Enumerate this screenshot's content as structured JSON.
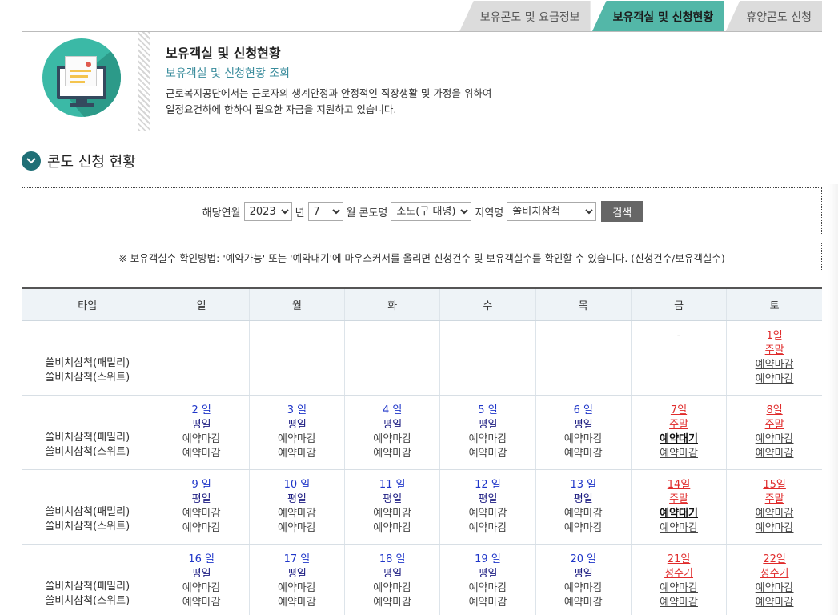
{
  "tabs": [
    {
      "label": "보유콘도 및 요금정보",
      "active": false
    },
    {
      "label": "보유객실 및 신청현황",
      "active": true
    },
    {
      "label": "휴양콘도 신청",
      "active": false
    }
  ],
  "intro": {
    "title": "보유객실 및 신청현황",
    "subtitle": "보유객실 및 신청현황 조회",
    "desc_line1": "근로복지공단에서는 근로자의 생계안정과 안정적인 직장생활 및 가정을 위하여",
    "desc_line2": "일정요건하에 한하여 필요한 자금을 지원하고 있습니다."
  },
  "section": {
    "title": "콘도 신청 현황"
  },
  "search": {
    "year_label": "해당연월",
    "year": "2023",
    "year_unit": "년",
    "month": "7",
    "month_unit": "월",
    "condo_label": "콘도명",
    "condo": "소노(구 대명)",
    "region_label": "지역명",
    "region": "쏠비치삼척",
    "button": "검색"
  },
  "notice": "※ 보유객실수 확인방법: '예약가능' 또는 '예약대기'에 마우스커서를 올리면 신청건수 및 보유객실수를 확인할 수 있습니다. (신청건수/보유객실수)",
  "table": {
    "headers": [
      "타입",
      "일",
      "월",
      "화",
      "수",
      "목",
      "금",
      "토"
    ],
    "type_lines": [
      "쏠비치삼척(패밀리)",
      "쏠비치삼척(스위트)"
    ],
    "weeks": [
      {
        "cells": [
          {
            "empty": true
          },
          {
            "empty": true
          },
          {
            "empty": true
          },
          {
            "empty": true
          },
          {
            "empty": true
          },
          {
            "dash": "-"
          },
          {
            "day": "1일",
            "kind": "주말",
            "weekend": true,
            "l1": "예약마감",
            "l2": "예약마감",
            "l1bold": false
          }
        ]
      },
      {
        "cells": [
          {
            "day": "2 일",
            "kind": "평일",
            "weekend": false,
            "l1": "예약마감",
            "l2": "예약마감"
          },
          {
            "day": "3 일",
            "kind": "평일",
            "weekend": false,
            "l1": "예약마감",
            "l2": "예약마감"
          },
          {
            "day": "4 일",
            "kind": "평일",
            "weekend": false,
            "l1": "예약마감",
            "l2": "예약마감"
          },
          {
            "day": "5 일",
            "kind": "평일",
            "weekend": false,
            "l1": "예약마감",
            "l2": "예약마감"
          },
          {
            "day": "6 일",
            "kind": "평일",
            "weekend": false,
            "l1": "예약마감",
            "l2": "예약마감"
          },
          {
            "day": "7일",
            "kind": "주말",
            "weekend": true,
            "l1": "예약대기",
            "l2": "예약마감",
            "l1bold": true
          },
          {
            "day": "8일",
            "kind": "주말",
            "weekend": true,
            "l1": "예약마감",
            "l2": "예약마감",
            "l1bold": false
          }
        ]
      },
      {
        "cells": [
          {
            "day": "9 일",
            "kind": "평일",
            "weekend": false,
            "l1": "예약마감",
            "l2": "예약마감"
          },
          {
            "day": "10 일",
            "kind": "평일",
            "weekend": false,
            "l1": "예약마감",
            "l2": "예약마감"
          },
          {
            "day": "11 일",
            "kind": "평일",
            "weekend": false,
            "l1": "예약마감",
            "l2": "예약마감"
          },
          {
            "day": "12 일",
            "kind": "평일",
            "weekend": false,
            "l1": "예약마감",
            "l2": "예약마감"
          },
          {
            "day": "13 일",
            "kind": "평일",
            "weekend": false,
            "l1": "예약마감",
            "l2": "예약마감"
          },
          {
            "day": "14일",
            "kind": "주말",
            "weekend": true,
            "l1": "예약대기",
            "l2": "예약마감",
            "l1bold": true
          },
          {
            "day": "15일",
            "kind": "주말",
            "weekend": true,
            "l1": "예약마감",
            "l2": "예약마감",
            "l1bold": false
          }
        ]
      },
      {
        "cells": [
          {
            "day": "16 일",
            "kind": "평일",
            "weekend": false,
            "l1": "예약마감",
            "l2": "예약마감"
          },
          {
            "day": "17 일",
            "kind": "평일",
            "weekend": false,
            "l1": "예약마감",
            "l2": "예약마감"
          },
          {
            "day": "18 일",
            "kind": "평일",
            "weekend": false,
            "l1": "예약마감",
            "l2": "예약마감"
          },
          {
            "day": "19 일",
            "kind": "평일",
            "weekend": false,
            "l1": "예약마감",
            "l2": "예약마감"
          },
          {
            "day": "20 일",
            "kind": "평일",
            "weekend": false,
            "l1": "예약마감",
            "l2": "예약마감"
          },
          {
            "day": "21일",
            "kind": "성수기",
            "weekend": true,
            "l1": "예약마감",
            "l2": "예약마감",
            "l1bold": false
          },
          {
            "day": "22일",
            "kind": "성수기",
            "weekend": true,
            "l1": "예약마감",
            "l2": "예약마감",
            "l1bold": false
          }
        ]
      }
    ]
  },
  "colors": {
    "accent": "#53b7a8",
    "weekday": "#1f36c9",
    "weekend": "#e02b2b",
    "header_bg": "#eef3f7"
  }
}
